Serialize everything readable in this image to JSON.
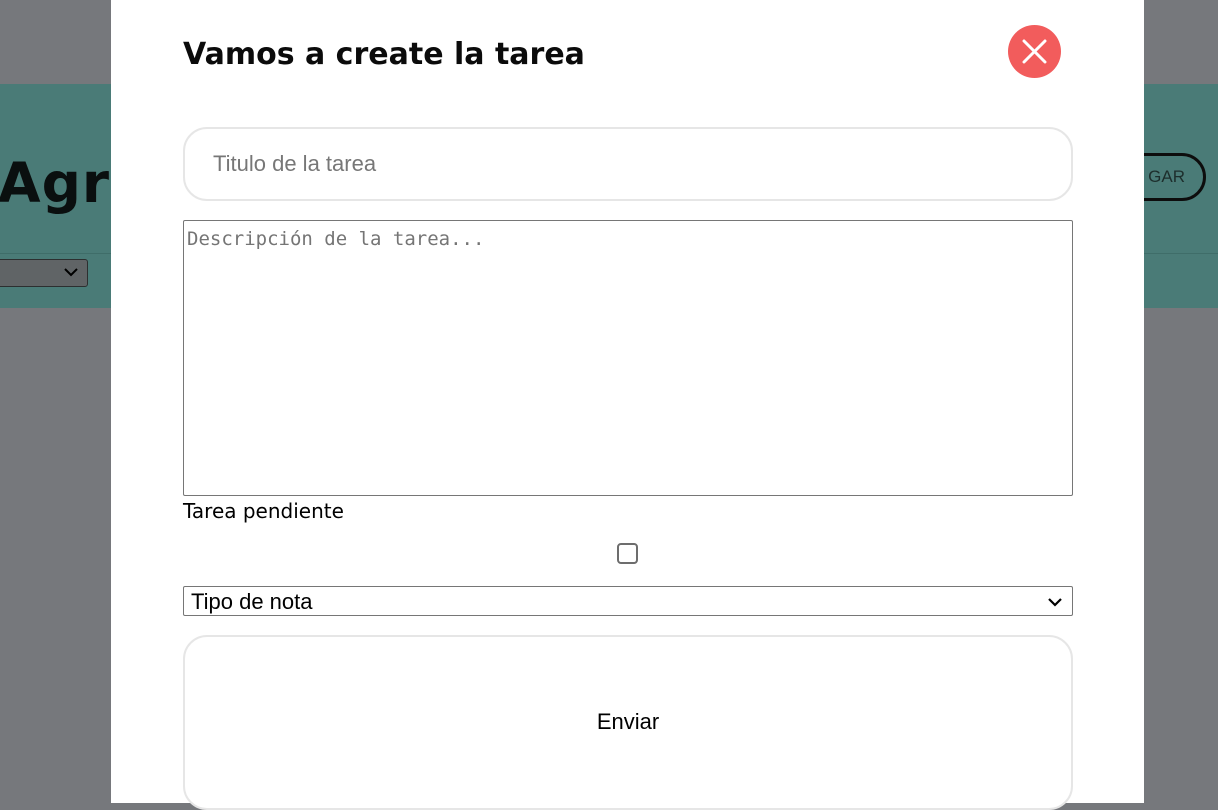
{
  "background": {
    "heading_fragment": "Agre",
    "button_fragment": "GAR",
    "colors": {
      "overlay": "#76787c",
      "header": "#4a7b77"
    }
  },
  "modal": {
    "title": "Vamos a create la tarea",
    "close_icon": "close-icon",
    "title_input": {
      "placeholder": "Titulo de la tarea",
      "value": ""
    },
    "description": {
      "placeholder": "Descripción de la tarea...",
      "value": ""
    },
    "pending_label": "Tarea pendiente",
    "pending_checked": false,
    "type_select": {
      "selected": "Tipo de nota",
      "icon": "chevron-down-icon"
    },
    "submit_label": "Enviar",
    "colors": {
      "close_button": "#f25c5c",
      "border": "#e6e6e6"
    }
  }
}
